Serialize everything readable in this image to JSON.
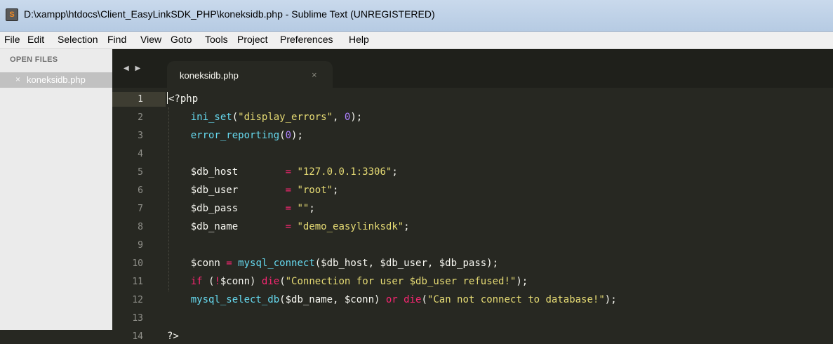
{
  "window": {
    "title": "D:\\xampp\\htdocs\\Client_EasyLinkSDK_PHP\\koneksidb.php - Sublime Text (UNREGISTERED)",
    "app_icon_letter": "S"
  },
  "menu": [
    "File",
    "Edit",
    "Selection",
    "Find",
    "View",
    "Goto",
    "Tools",
    "Project",
    "Preferences",
    "Help"
  ],
  "sidebar": {
    "header": "OPEN FILES",
    "file_close": "×",
    "file_name": "koneksidb.php"
  },
  "tabs": {
    "nav": "◀ ▶",
    "active_name": "koneksidb.php",
    "close": "×"
  },
  "editor": {
    "current_line": 1,
    "lines": [
      {
        "num": "1",
        "text": "<?php"
      },
      {
        "num": "2",
        "text": "    ini_set(\"display_errors\", 0);"
      },
      {
        "num": "3",
        "text": "    error_reporting(0);"
      },
      {
        "num": "4",
        "text": ""
      },
      {
        "num": "5",
        "text": "    $db_host        = \"127.0.0.1:3306\";"
      },
      {
        "num": "6",
        "text": "    $db_user        = \"root\";"
      },
      {
        "num": "7",
        "text": "    $db_pass        = \"\";"
      },
      {
        "num": "8",
        "text": "    $db_name        = \"demo_easylinksdk\";"
      },
      {
        "num": "9",
        "text": ""
      },
      {
        "num": "10",
        "text": "    $conn = mysql_connect($db_host, $db_user, $db_pass);"
      },
      {
        "num": "11",
        "text": "    if (!$conn) die(\"Connection for user $db_user refused!\");"
      },
      {
        "num": "12",
        "text": "    mysql_select_db($db_name, $conn) or die(\"Can not connect to database!\");"
      },
      {
        "num": "13",
        "text": ""
      },
      {
        "num": "14",
        "text": "?>"
      }
    ]
  },
  "theme": {
    "background": "#272822",
    "text": "#f8f8f2",
    "keyword": "#f92672",
    "function": "#66d9ef",
    "string": "#e6db74",
    "number": "#ae81ff"
  }
}
